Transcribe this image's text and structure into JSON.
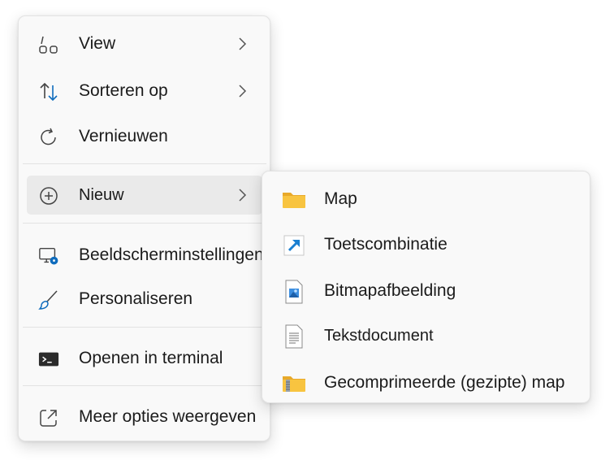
{
  "context_menu": {
    "items": [
      {
        "label": "View",
        "icon": "view-icon",
        "has_submenu": true
      },
      {
        "label": "Sorteren op",
        "icon": "sort-icon",
        "has_submenu": true
      },
      {
        "label": "Vernieuwen",
        "icon": "refresh-icon",
        "has_submenu": false
      },
      {
        "label": "Nieuw",
        "icon": "add-circle-icon",
        "has_submenu": true,
        "highlighted": true
      },
      {
        "label": "Beeldscherminstellingen",
        "icon": "display-settings-icon",
        "has_submenu": false
      },
      {
        "label": "Personaliseren",
        "icon": "brush-icon",
        "has_submenu": false
      },
      {
        "label": "Openen in terminal",
        "icon": "terminal-icon",
        "has_submenu": false
      },
      {
        "label": "Meer opties weergeven",
        "icon": "share-open-icon",
        "has_submenu": false
      }
    ]
  },
  "new_submenu": {
    "items": [
      {
        "label": "Map",
        "icon": "folder-icon"
      },
      {
        "label": "Toetscombinatie",
        "icon": "shortcut-icon"
      },
      {
        "label": "Bitmapafbeelding",
        "icon": "bitmap-image-icon"
      },
      {
        "label": "Tekstdocument",
        "icon": "text-document-icon"
      },
      {
        "label": "Gecomprimeerde (gezipte) map",
        "icon": "zip-folder-icon"
      }
    ]
  },
  "colors": {
    "menu_background": "#f9f9f9",
    "highlight": "#eaeaea",
    "accent_blue": "#0f6cbd",
    "folder_yellow": "#f8c440",
    "icon_gray": "#444444"
  }
}
